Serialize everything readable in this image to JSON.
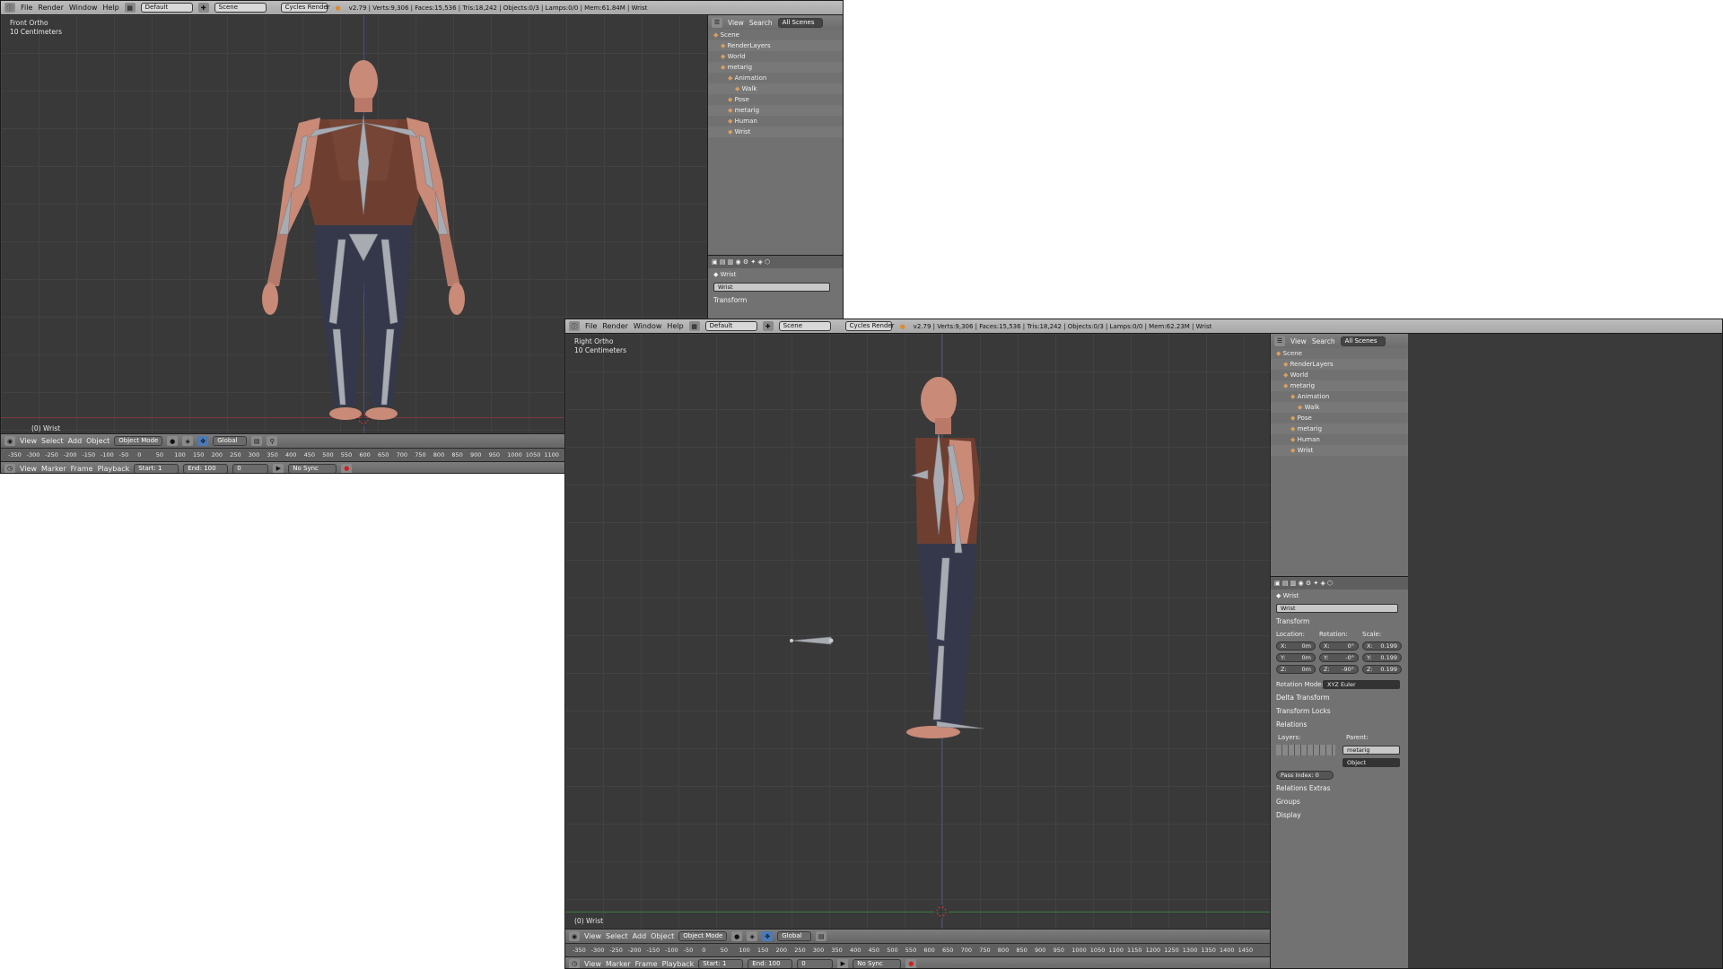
{
  "window1": {
    "menus": [
      "File",
      "Render",
      "Window",
      "Help"
    ],
    "layout": "Default",
    "scene": "Scene",
    "engine": "Cycles Render",
    "stats": "v2.79 | Verts:9,306 | Faces:15,536 | Tris:18,242 | Objects:0/3 | Lamps:0/0 | Mem:61.84M | Wrist",
    "view_name": "Front Ortho",
    "view_scale": "10 Centimeters",
    "object_label": "(0) Wrist",
    "header": {
      "items": [
        "View",
        "Select",
        "Add",
        "Object"
      ],
      "mode": "Object Mode",
      "orientation": "Global"
    },
    "ruler_ticks": [
      "-350",
      "-300",
      "-250",
      "-200",
      "-150",
      "-100",
      "-50",
      "0",
      "50",
      "100",
      "150",
      "200",
      "250",
      "300",
      "350",
      "400",
      "450",
      "500",
      "550",
      "600",
      "650",
      "700",
      "750",
      "800",
      "850",
      "900",
      "950",
      "1000",
      "1050",
      "1100"
    ],
    "timeline": {
      "items": [
        "View",
        "Marker",
        "Frame",
        "Playback"
      ],
      "start_label": "Start:",
      "start": "1",
      "end_label": "End:",
      "end": "100",
      "frame": "0",
      "sync": "No Sync"
    },
    "outliner": {
      "view": "View",
      "search": "Search",
      "filter": "All Scenes",
      "rows": [
        "Scene",
        "RenderLayers",
        "World",
        "metarig",
        "Animation",
        "Walk",
        "Pose",
        "metarig",
        "Human",
        "Wrist"
      ]
    },
    "props": {
      "object": "Wrist",
      "name_field": "Wrist",
      "section": "Transform"
    }
  },
  "window2": {
    "menus": [
      "File",
      "Render",
      "Window",
      "Help"
    ],
    "layout": "Default",
    "scene": "Scene",
    "engine": "Cycles Render",
    "stats": "v2.79 | Verts:9,306 | Faces:15,536 | Tris:18,242 | Objects:0/3 | Lamps:0/0 | Mem:62.23M | Wrist",
    "view_name": "Right Ortho",
    "view_scale": "10 Centimeters",
    "object_label": "(0) Wrist",
    "header": {
      "items": [
        "View",
        "Select",
        "Add",
        "Object"
      ],
      "mode": "Object Mode",
      "orientation": "Global"
    },
    "ruler_ticks": [
      "-350",
      "-300",
      "-250",
      "-200",
      "-150",
      "-100",
      "-50",
      "0",
      "50",
      "100",
      "150",
      "200",
      "250",
      "300",
      "350",
      "400",
      "450",
      "500",
      "550",
      "600",
      "650",
      "700",
      "750",
      "800",
      "850",
      "900",
      "950",
      "1000",
      "1050",
      "1100",
      "1150",
      "1200",
      "1250",
      "1300",
      "1350",
      "1400",
      "1450"
    ],
    "timeline": {
      "items": [
        "View",
        "Marker",
        "Frame",
        "Playback"
      ],
      "start_label": "Start:",
      "start": "1",
      "end_label": "End:",
      "end": "100",
      "frame": "0",
      "sync": "No Sync"
    },
    "outliner": {
      "view": "View",
      "search": "Search",
      "filter": "All Scenes",
      "rows": [
        "Scene",
        "RenderLayers",
        "World",
        "metarig",
        "Animation",
        "Walk",
        "Pose",
        "metarig",
        "Human",
        "Wrist"
      ]
    },
    "props": {
      "object": "Wrist",
      "name_field": "Wrist",
      "transform": "Transform",
      "location_label": "Location:",
      "rotation_label": "Rotation:",
      "scale_label": "Scale:",
      "loc": [
        "X:",
        "0m",
        "Y:",
        "0m",
        "Z:",
        "0m"
      ],
      "rot": [
        "X:",
        "0°",
        "Y:",
        "-0°",
        "Z:",
        "-90°"
      ],
      "scl": [
        "X:",
        "0.199",
        "Y:",
        "0.199",
        "Z:",
        "0.199"
      ],
      "rotation_mode_label": "Rotation Mode:",
      "rotation_mode": "XYZ Euler",
      "delta": "Delta Transform",
      "locks": "Transform Locks",
      "relations": "Relations",
      "layers_label": "Layers:",
      "parent_label": "Parent:",
      "parent": "metarig",
      "parent_type": "Object",
      "pass_index": "Pass Index:",
      "pass_value": "0",
      "rel_extras": "Relations Extras",
      "groups": "Groups",
      "display": "Display"
    }
  },
  "colors": {
    "skin": "#c98a78",
    "shirt": "#6e3f30",
    "pants": "#34384a",
    "bone": "#a9abb2"
  }
}
